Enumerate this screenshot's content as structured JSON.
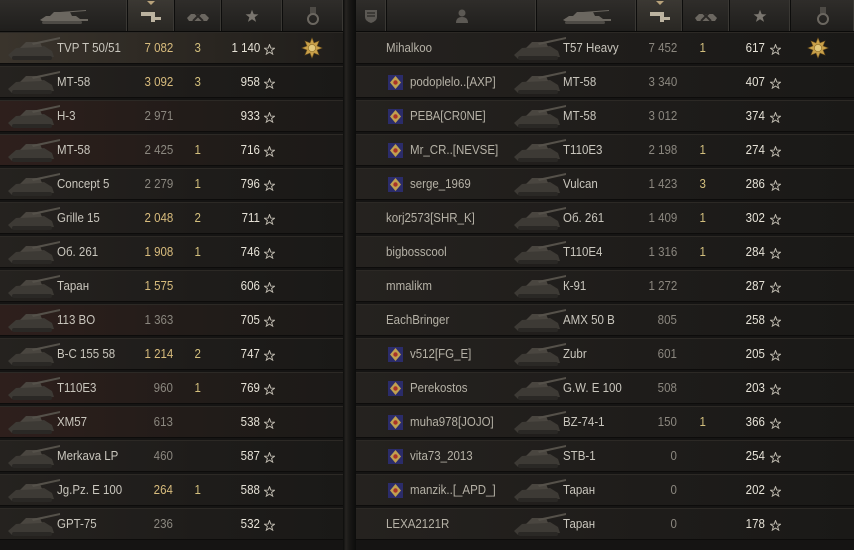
{
  "left_team": {
    "rows": [
      {
        "tank": "TVP T 50/51",
        "damage": "7 082",
        "kills": "3",
        "exp": "1 140",
        "medal": true,
        "highlight": "me",
        "dmg_hi": true
      },
      {
        "tank": "МТ-58",
        "damage": "3 092",
        "kills": "3",
        "exp": "958",
        "dmg_hi": true
      },
      {
        "tank": "Н-3",
        "damage": "2 971",
        "kills": "",
        "exp": "933",
        "highlight": "red"
      },
      {
        "tank": "МТ-58",
        "damage": "2 425",
        "kills": "1",
        "exp": "716",
        "highlight": "red"
      },
      {
        "tank": "Concept 5",
        "damage": "2 279",
        "kills": "1",
        "exp": "796"
      },
      {
        "tank": "Grille 15",
        "damage": "2 048",
        "kills": "2",
        "exp": "711",
        "dmg_hi": true
      },
      {
        "tank": "Об. 261",
        "damage": "1 908",
        "kills": "1",
        "exp": "746",
        "dmg_hi": true
      },
      {
        "tank": "Таран",
        "damage": "1 575",
        "kills": "",
        "exp": "606",
        "dmg_hi": true
      },
      {
        "tank": "113 BO",
        "damage": "1 363",
        "kills": "",
        "exp": "705",
        "highlight": "red"
      },
      {
        "tank": "В-С 155 58",
        "damage": "1 214",
        "kills": "2",
        "exp": "747",
        "dmg_hi": true
      },
      {
        "tank": "T110E3",
        "damage": "960",
        "kills": "1",
        "exp": "769",
        "highlight": "red"
      },
      {
        "tank": "XM57",
        "damage": "613",
        "kills": "",
        "exp": "538",
        "highlight": "red"
      },
      {
        "tank": "Merkava LP",
        "damage": "460",
        "kills": "",
        "exp": "587"
      },
      {
        "tank": "Jg.Pz. E 100",
        "damage": "264",
        "kills": "1",
        "exp": "588",
        "dmg_hi": true
      },
      {
        "tank": "GPT-75",
        "damage": "236",
        "kills": "",
        "exp": "532"
      }
    ]
  },
  "right_team": {
    "rows": [
      {
        "player": "Mihalkoo",
        "badge": "",
        "tank": "T57 Heavy",
        "damage": "7 452",
        "kills": "1",
        "exp": "617",
        "medal": true
      },
      {
        "player": "podoplelo..[AXP]",
        "badge": "badge-icon",
        "tank": "МТ-58",
        "damage": "3 340",
        "kills": "",
        "exp": "407"
      },
      {
        "player": "РЕВА[CR0NE]",
        "badge": "badge-icon",
        "tank": "МТ-58",
        "damage": "3 012",
        "kills": "",
        "exp": "374"
      },
      {
        "player": "Mr_CR..[NEVSE]",
        "badge": "badge-icon",
        "tank": "T110E3",
        "damage": "2 198",
        "kills": "1",
        "exp": "274"
      },
      {
        "player": "serge_1969",
        "badge": "badge-icon",
        "tank": "Vulcan",
        "damage": "1 423",
        "kills": "3",
        "exp": "286"
      },
      {
        "player": "korj2573[SHR_K]",
        "badge": "",
        "tank": "Об. 261",
        "damage": "1 409",
        "kills": "1",
        "exp": "302"
      },
      {
        "player": "bigbosscool",
        "badge": "",
        "tank": "T110E4",
        "damage": "1 316",
        "kills": "1",
        "exp": "284"
      },
      {
        "player": "mmalikm",
        "badge": "",
        "tank": "К-91",
        "damage": "1 272",
        "kills": "",
        "exp": "287"
      },
      {
        "player": "EachBringer",
        "badge": "",
        "tank": "AMX 50 B",
        "damage": "805",
        "kills": "",
        "exp": "258"
      },
      {
        "player": "v512[FG_E]",
        "badge": "badge-icon",
        "tank": "Zubr",
        "damage": "601",
        "kills": "",
        "exp": "205"
      },
      {
        "player": "Perekostos",
        "badge": "badge-icon",
        "tank": "G.W. E 100",
        "damage": "508",
        "kills": "",
        "exp": "203"
      },
      {
        "player": "muha978[JOJO]",
        "badge": "badge-icon",
        "tank": "BZ-74-1",
        "damage": "150",
        "kills": "1",
        "exp": "366"
      },
      {
        "player": "vita73_2013",
        "badge": "badge-icon",
        "tank": "STB-1",
        "damage": "0",
        "kills": "",
        "exp": "254"
      },
      {
        "player": "manzik..[_APD_]",
        "badge": "badge-icon",
        "tank": "Таран",
        "damage": "0",
        "kills": "",
        "exp": "202"
      },
      {
        "player": "LEXA2121R",
        "badge": "",
        "tank": "Таран",
        "damage": "0",
        "kills": "",
        "exp": "178"
      }
    ]
  },
  "colors": {
    "accent": "#d8bc7d",
    "text": "#c9c6bd",
    "dim": "#8b877f",
    "exp": "#e6e2d7"
  }
}
